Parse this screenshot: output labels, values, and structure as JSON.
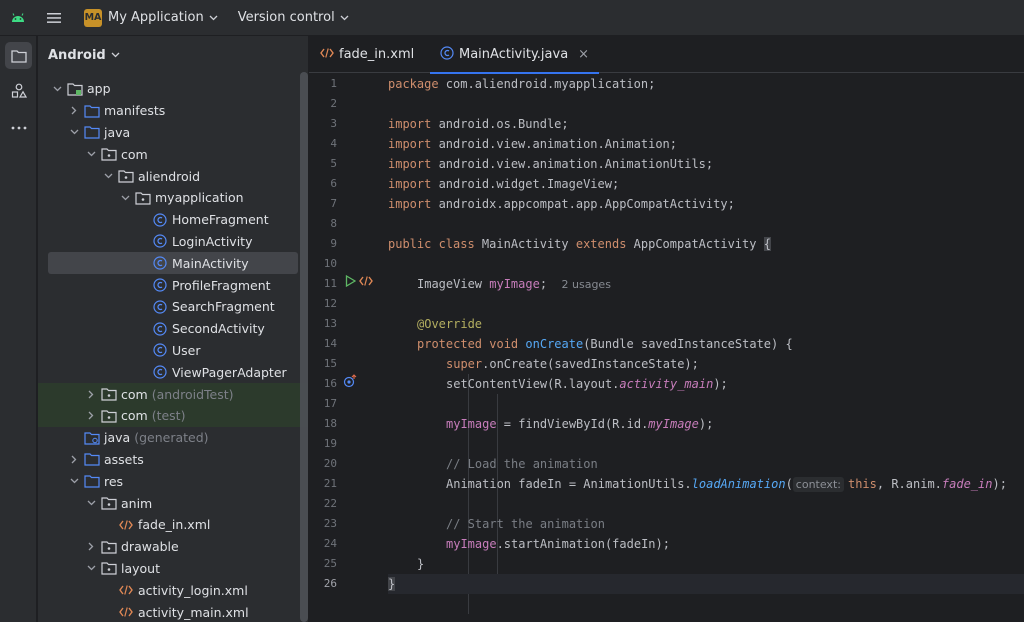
{
  "titlebar": {
    "project_badge": "MA",
    "project_name": "My Application",
    "vcs_label": "Version control"
  },
  "project_panel": {
    "view_label": "Android",
    "tree": [
      {
        "label": "app",
        "suffix": "",
        "depth": 0,
        "expanded": true,
        "icon": "module-folder-icon"
      },
      {
        "label": "manifests",
        "suffix": "",
        "depth": 1,
        "expanded": false,
        "icon": "folder-icon"
      },
      {
        "label": "java",
        "suffix": "",
        "depth": 1,
        "expanded": true,
        "icon": "folder-icon"
      },
      {
        "label": "com",
        "suffix": "",
        "depth": 2,
        "expanded": true,
        "icon": "package-icon"
      },
      {
        "label": "aliendroid",
        "suffix": "",
        "depth": 3,
        "expanded": true,
        "icon": "package-icon"
      },
      {
        "label": "myapplication",
        "suffix": "",
        "depth": 4,
        "expanded": true,
        "icon": "package-icon"
      },
      {
        "label": "HomeFragment",
        "suffix": "",
        "depth": 5,
        "icon": "class-icon"
      },
      {
        "label": "LoginActivity",
        "suffix": "",
        "depth": 5,
        "icon": "class-icon"
      },
      {
        "label": "MainActivity",
        "suffix": "",
        "depth": 5,
        "icon": "class-icon",
        "selected": true
      },
      {
        "label": "ProfileFragment",
        "suffix": "",
        "depth": 5,
        "icon": "class-icon"
      },
      {
        "label": "SearchFragment",
        "suffix": "",
        "depth": 5,
        "icon": "class-icon"
      },
      {
        "label": "SecondActivity",
        "suffix": "",
        "depth": 5,
        "icon": "class-icon"
      },
      {
        "label": "User",
        "suffix": "",
        "depth": 5,
        "icon": "class-icon"
      },
      {
        "label": "ViewPagerAdapter",
        "suffix": "",
        "depth": 5,
        "icon": "class-icon"
      },
      {
        "label": "com",
        "suffix": "(androidTest)",
        "depth": 2,
        "expanded": false,
        "icon": "package-icon",
        "test": true
      },
      {
        "label": "com",
        "suffix": "(test)",
        "depth": 2,
        "expanded": false,
        "icon": "package-icon",
        "test": true
      },
      {
        "label": "java",
        "suffix": "(generated)",
        "depth": 1,
        "icon": "generated-folder-icon"
      },
      {
        "label": "assets",
        "suffix": "",
        "depth": 1,
        "expanded": false,
        "icon": "folder-icon"
      },
      {
        "label": "res",
        "suffix": "",
        "depth": 1,
        "expanded": true,
        "icon": "folder-icon"
      },
      {
        "label": "anim",
        "suffix": "",
        "depth": 2,
        "expanded": true,
        "icon": "package-icon"
      },
      {
        "label": "fade_in.xml",
        "suffix": "",
        "depth": 3,
        "icon": "xml-icon"
      },
      {
        "label": "drawable",
        "suffix": "",
        "depth": 2,
        "expanded": false,
        "icon": "package-icon"
      },
      {
        "label": "layout",
        "suffix": "",
        "depth": 2,
        "expanded": true,
        "icon": "package-icon"
      },
      {
        "label": "activity_login.xml",
        "suffix": "",
        "depth": 3,
        "icon": "xml-icon"
      },
      {
        "label": "activity_main.xml",
        "suffix": "",
        "depth": 3,
        "icon": "xml-icon"
      }
    ]
  },
  "editor": {
    "tabs": [
      {
        "label": "fade_in.xml",
        "icon": "xml-icon",
        "active": false
      },
      {
        "label": "MainActivity.java",
        "icon": "class-icon",
        "active": true
      }
    ],
    "tab_close_glyph": "×",
    "line_numbers": [
      "1",
      "2",
      "3",
      "4",
      "5",
      "6",
      "7",
      "8",
      "9",
      "10",
      "11",
      "12",
      "13",
      "14",
      "15",
      "16",
      "17",
      "18",
      "19",
      "20",
      "21",
      "22",
      "23",
      "24",
      "25",
      "26"
    ],
    "code": {
      "l1": {
        "kw": "package",
        "rest": " com.aliendroid.myapplication;"
      },
      "l3": {
        "kw": "import",
        "rest": " android.os.Bundle;"
      },
      "l4": {
        "kw": "import",
        "rest": " android.view.animation.Animation;"
      },
      "l5": {
        "kw": "import",
        "rest": " android.view.animation.AnimationUtils;"
      },
      "l6": {
        "kw": "import",
        "rest": " android.widget.ImageView;"
      },
      "l7": {
        "kw": "import",
        "rest": " androidx.appcompat.app.AppCompatActivity;"
      },
      "l9": {
        "kw1": "public class",
        "name": " MainActivity ",
        "kw2": "extends",
        "base": " AppCompatActivity ",
        "brace": "{"
      },
      "l11": {
        "type": "ImageView ",
        "field": "myImage",
        "semi": ";",
        "hint": "2 usages"
      },
      "l13": {
        "ann": "@Override"
      },
      "l14": {
        "kw": "protected void",
        "sp": " ",
        "fn": "onCreate",
        "rest": "(Bundle savedInstanceState) {"
      },
      "l15": {
        "kw": "super",
        "rest": ".onCreate(savedInstanceState);"
      },
      "l16": {
        "a": "setContentView(R.layout.",
        "f": "activity_main",
        "b": ");"
      },
      "l18": {
        "f1": "myImage",
        "a": " = findViewById(R.id.",
        "f2": "myImage",
        "b": ");"
      },
      "l20": {
        "cm": "// Load the animation"
      },
      "l21": {
        "a": "Animation fadeIn = AnimationUtils.",
        "fn": "loadAnimation",
        "p": "(",
        "hint": "context:",
        "kw": "this",
        "b": ", R.anim.",
        "f": "fade_in",
        "c": ");"
      },
      "l23": {
        "cm": "// Start the animation"
      },
      "l24": {
        "f": "myImage",
        "a": ".startAnimation(fadeIn);"
      },
      "l25": {
        "a": "}"
      },
      "l26": {
        "a": "}"
      }
    }
  }
}
